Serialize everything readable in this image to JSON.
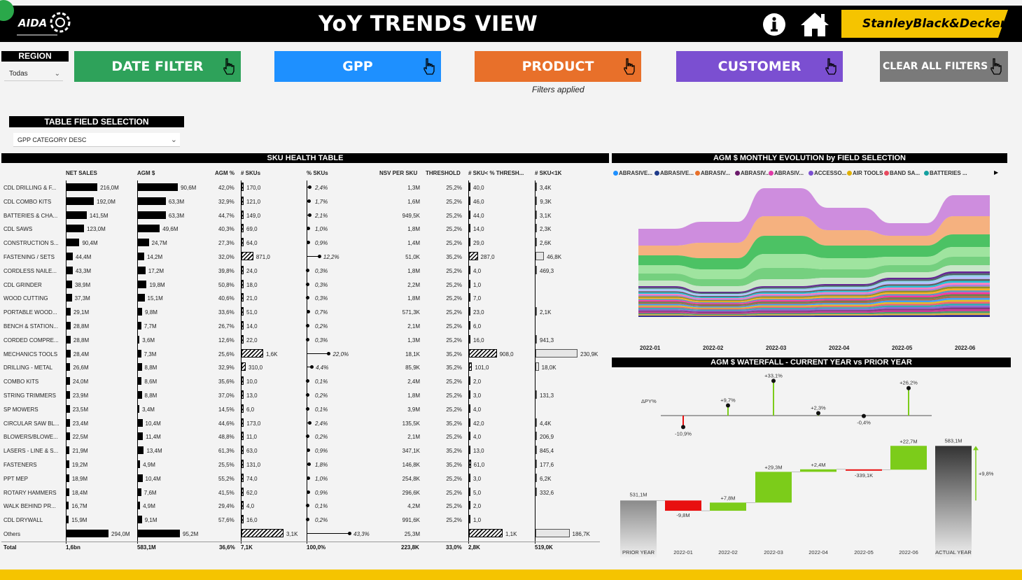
{
  "header": {
    "logo_text": "AIDA",
    "title": "YoY TRENDS VIEW",
    "brand": "StanleyBlack&Decker"
  },
  "region": {
    "label": "REGION",
    "value": "Todas"
  },
  "nav": {
    "date_filter": "DATE FILTER",
    "gpp": "GPP",
    "product": "PRODUCT",
    "customer": "CUSTOMER",
    "clear": "CLEAR ALL FILTERS",
    "filters_applied": "Filters applied"
  },
  "colors": {
    "date": "#2ea25a",
    "gpp": "#1e90ff",
    "product": "#e8702a",
    "customer": "#7b4fd1",
    "clear": "#7a7a7a",
    "footer": "#f5c400"
  },
  "table_field": {
    "label": "TABLE FIELD SELECTION",
    "value": "GPP CATEGORY DESC"
  },
  "sku_table": {
    "title": "SKU HEALTH TABLE",
    "columns": [
      "NET SALES",
      "AGM $",
      "AGM %",
      "# SKUs",
      "% SKUs",
      "NSV PER SKU",
      "THRESHOLD",
      "# SKU< % THRESH...",
      "# SKU<1K"
    ],
    "rows": [
      {
        "name": "CDL DRILLING & F...",
        "net_sales": "216,0M",
        "ns": 216.0,
        "agm": "90,6M",
        "agm_v": 90.6,
        "agm_pct": "42,0%",
        "skus": "170,0",
        "skus_v": 170,
        "pct_skus": "2,4%",
        "pct_v": 2.4,
        "nsv": "1,3M",
        "thr": "25,2%",
        "below": "40,0",
        "below_v": 40,
        "lt1k": "3,4K",
        "lt1k_v": 3.4
      },
      {
        "name": "CDL COMBO KITS",
        "net_sales": "192,0M",
        "ns": 192.0,
        "agm": "63,3M",
        "agm_v": 63.3,
        "agm_pct": "32,9%",
        "skus": "121,0",
        "skus_v": 121,
        "pct_skus": "1,7%",
        "pct_v": 1.7,
        "nsv": "1,6M",
        "thr": "25,2%",
        "below": "46,0",
        "below_v": 46,
        "lt1k": "9,3K",
        "lt1k_v": 9.3
      },
      {
        "name": "BATTERIES & CHA...",
        "net_sales": "141,5M",
        "ns": 141.5,
        "agm": "63,3M",
        "agm_v": 63.3,
        "agm_pct": "44,7%",
        "skus": "149,0",
        "skus_v": 149,
        "pct_skus": "2,1%",
        "pct_v": 2.1,
        "nsv": "949,5K",
        "thr": "25,2%",
        "below": "44,0",
        "below_v": 44,
        "lt1k": "3,1K",
        "lt1k_v": 3.1
      },
      {
        "name": "CDL SAWS",
        "net_sales": "123,0M",
        "ns": 123.0,
        "agm": "49,6M",
        "agm_v": 49.6,
        "agm_pct": "40,3%",
        "skus": "69,0",
        "skus_v": 69,
        "pct_skus": "1,0%",
        "pct_v": 1.0,
        "nsv": "1,8M",
        "thr": "25,2%",
        "below": "14,0",
        "below_v": 14,
        "lt1k": "2,3K",
        "lt1k_v": 2.3
      },
      {
        "name": "CONSTRUCTION S...",
        "net_sales": "90,4M",
        "ns": 90.4,
        "agm": "24,7M",
        "agm_v": 24.7,
        "agm_pct": "27,3%",
        "skus": "64,0",
        "skus_v": 64,
        "pct_skus": "0,9%",
        "pct_v": 0.9,
        "nsv": "1,4M",
        "thr": "25,2%",
        "below": "29,0",
        "below_v": 29,
        "lt1k": "2,6K",
        "lt1k_v": 2.6
      },
      {
        "name": "FASTENING / SETS",
        "net_sales": "44,4M",
        "ns": 44.4,
        "agm": "14,2M",
        "agm_v": 14.2,
        "agm_pct": "32,0%",
        "skus": "871,0",
        "skus_v": 871,
        "pct_skus": "12,2%",
        "pct_v": 12.2,
        "nsv": "51,0K",
        "thr": "35,2%",
        "below": "287,0",
        "below_v": 287,
        "lt1k": "46,8K",
        "lt1k_v": 46.8
      },
      {
        "name": "CORDLESS NAILE...",
        "net_sales": "43,3M",
        "ns": 43.3,
        "agm": "17,2M",
        "agm_v": 17.2,
        "agm_pct": "39,8%",
        "skus": "24,0",
        "skus_v": 24,
        "pct_skus": "0,3%",
        "pct_v": 0.3,
        "nsv": "1,8M",
        "thr": "25,2%",
        "below": "4,0",
        "below_v": 4,
        "lt1k": "469,3",
        "lt1k_v": 0.4693
      },
      {
        "name": "CDL GRINDER",
        "net_sales": "38,9M",
        "ns": 38.9,
        "agm": "19,8M",
        "agm_v": 19.8,
        "agm_pct": "50,8%",
        "skus": "18,0",
        "skus_v": 18,
        "pct_skus": "0,3%",
        "pct_v": 0.3,
        "nsv": "2,2M",
        "thr": "25,2%",
        "below": "1,0",
        "below_v": 1,
        "lt1k": "",
        "lt1k_v": 0
      },
      {
        "name": "WOOD CUTTING",
        "net_sales": "37,3M",
        "ns": 37.3,
        "agm": "15,1M",
        "agm_v": 15.1,
        "agm_pct": "40,6%",
        "skus": "21,0",
        "skus_v": 21,
        "pct_skus": "0,3%",
        "pct_v": 0.3,
        "nsv": "1,8M",
        "thr": "25,2%",
        "below": "7,0",
        "below_v": 7,
        "lt1k": "",
        "lt1k_v": 0
      },
      {
        "name": "PORTABLE WOOD...",
        "net_sales": "29,1M",
        "ns": 29.1,
        "agm": "9,8M",
        "agm_v": 9.8,
        "agm_pct": "33,6%",
        "skus": "51,0",
        "skus_v": 51,
        "pct_skus": "0,7%",
        "pct_v": 0.7,
        "nsv": "571,3K",
        "thr": "25,2%",
        "below": "23,0",
        "below_v": 23,
        "lt1k": "2,1K",
        "lt1k_v": 2.1
      },
      {
        "name": "BENCH & STATION...",
        "net_sales": "28,8M",
        "ns": 28.8,
        "agm": "7,7M",
        "agm_v": 7.7,
        "agm_pct": "26,7%",
        "skus": "14,0",
        "skus_v": 14,
        "pct_skus": "0,2%",
        "pct_v": 0.2,
        "nsv": "2,1M",
        "thr": "25,2%",
        "below": "6,0",
        "below_v": 6,
        "lt1k": "",
        "lt1k_v": 0
      },
      {
        "name": "CORDED COMPRE...",
        "net_sales": "28,8M",
        "ns": 28.8,
        "agm": "3,6M",
        "agm_v": 3.6,
        "agm_pct": "12,6%",
        "skus": "22,0",
        "skus_v": 22,
        "pct_skus": "0,3%",
        "pct_v": 0.3,
        "nsv": "1,3M",
        "thr": "25,2%",
        "below": "16,0",
        "below_v": 16,
        "lt1k": "941,3",
        "lt1k_v": 0.9413
      },
      {
        "name": "MECHANICS TOOLS",
        "net_sales": "28,4M",
        "ns": 28.4,
        "agm": "7,3M",
        "agm_v": 7.3,
        "agm_pct": "25,6%",
        "skus": "1,6K",
        "skus_v": 1600,
        "pct_skus": "22,0%",
        "pct_v": 22.0,
        "nsv": "18,1K",
        "thr": "35,2%",
        "below": "908,0",
        "below_v": 908,
        "lt1k": "230,9K",
        "lt1k_v": 230.9
      },
      {
        "name": "DRILLING - METAL",
        "net_sales": "26,6M",
        "ns": 26.6,
        "agm": "8,8M",
        "agm_v": 8.8,
        "agm_pct": "32,9%",
        "skus": "310,0",
        "skus_v": 310,
        "pct_skus": "4,4%",
        "pct_v": 4.4,
        "nsv": "85,9K",
        "thr": "35,2%",
        "below": "101,0",
        "below_v": 101,
        "lt1k": "18,0K",
        "lt1k_v": 18.0
      },
      {
        "name": "COMBO KITS",
        "net_sales": "24,0M",
        "ns": 24.0,
        "agm": "8,6M",
        "agm_v": 8.6,
        "agm_pct": "35,6%",
        "skus": "10,0",
        "skus_v": 10,
        "pct_skus": "0,1%",
        "pct_v": 0.1,
        "nsv": "2,4M",
        "thr": "25,2%",
        "below": "2,0",
        "below_v": 2,
        "lt1k": "",
        "lt1k_v": 0
      },
      {
        "name": "STRING TRIMMERS",
        "net_sales": "23,9M",
        "ns": 23.9,
        "agm": "8,8M",
        "agm_v": 8.8,
        "agm_pct": "37,0%",
        "skus": "13,0",
        "skus_v": 13,
        "pct_skus": "0,2%",
        "pct_v": 0.2,
        "nsv": "1,8M",
        "thr": "25,2%",
        "below": "3,0",
        "below_v": 3,
        "lt1k": "131,3",
        "lt1k_v": 0.1313
      },
      {
        "name": "SP MOWERS",
        "net_sales": "23,5M",
        "ns": 23.5,
        "agm": "3,4M",
        "agm_v": 3.4,
        "agm_pct": "14,5%",
        "skus": "6,0",
        "skus_v": 6,
        "pct_skus": "0,1%",
        "pct_v": 0.1,
        "nsv": "3,9M",
        "thr": "25,2%",
        "below": "4,0",
        "below_v": 4,
        "lt1k": "",
        "lt1k_v": 0
      },
      {
        "name": "CIRCULAR SAW BL...",
        "net_sales": "23,4M",
        "ns": 23.4,
        "agm": "10,4M",
        "agm_v": 10.4,
        "agm_pct": "44,6%",
        "skus": "173,0",
        "skus_v": 173,
        "pct_skus": "2,4%",
        "pct_v": 2.4,
        "nsv": "135,5K",
        "thr": "35,2%",
        "below": "42,0",
        "below_v": 42,
        "lt1k": "4,4K",
        "lt1k_v": 4.4
      },
      {
        "name": "BLOWERS/BLOWE...",
        "net_sales": "22,5M",
        "ns": 22.5,
        "agm": "11,4M",
        "agm_v": 11.4,
        "agm_pct": "48,8%",
        "skus": "11,0",
        "skus_v": 11,
        "pct_skus": "0,2%",
        "pct_v": 0.2,
        "nsv": "2,1M",
        "thr": "25,2%",
        "below": "4,0",
        "below_v": 4,
        "lt1k": "206,9",
        "lt1k_v": 0.2069
      },
      {
        "name": "LASERS - LINE & S...",
        "net_sales": "21,9M",
        "ns": 21.9,
        "agm": "13,4M",
        "agm_v": 13.4,
        "agm_pct": "61,3%",
        "skus": "63,0",
        "skus_v": 63,
        "pct_skus": "0,9%",
        "pct_v": 0.9,
        "nsv": "347,1K",
        "thr": "35,2%",
        "below": "13,0",
        "below_v": 13,
        "lt1k": "845,4",
        "lt1k_v": 0.8454
      },
      {
        "name": "FASTENERS",
        "net_sales": "19,2M",
        "ns": 19.2,
        "agm": "4,9M",
        "agm_v": 4.9,
        "agm_pct": "25,5%",
        "skus": "131,0",
        "skus_v": 131,
        "pct_skus": "1,8%",
        "pct_v": 1.8,
        "nsv": "146,8K",
        "thr": "35,2%",
        "below": "61,0",
        "below_v": 61,
        "lt1k": "177,6",
        "lt1k_v": 0.1776
      },
      {
        "name": "PPT MEP",
        "net_sales": "18,9M",
        "ns": 18.9,
        "agm": "10,4M",
        "agm_v": 10.4,
        "agm_pct": "55,2%",
        "skus": "74,0",
        "skus_v": 74,
        "pct_skus": "1,0%",
        "pct_v": 1.0,
        "nsv": "254,8K",
        "thr": "25,2%",
        "below": "3,0",
        "below_v": 3,
        "lt1k": "6,2K",
        "lt1k_v": 6.2
      },
      {
        "name": "ROTARY HAMMERS",
        "net_sales": "18,4M",
        "ns": 18.4,
        "agm": "7,6M",
        "agm_v": 7.6,
        "agm_pct": "41,5%",
        "skus": "62,0",
        "skus_v": 62,
        "pct_skus": "0,9%",
        "pct_v": 0.9,
        "nsv": "296,6K",
        "thr": "25,2%",
        "below": "5,0",
        "below_v": 5,
        "lt1k": "332,6",
        "lt1k_v": 0.3326
      },
      {
        "name": "WALK BEHIND PR...",
        "net_sales": "16,7M",
        "ns": 16.7,
        "agm": "4,9M",
        "agm_v": 4.9,
        "agm_pct": "29,4%",
        "skus": "4,0",
        "skus_v": 4,
        "pct_skus": "0,1%",
        "pct_v": 0.1,
        "nsv": "4,2M",
        "thr": "25,2%",
        "below": "2,0",
        "below_v": 2,
        "lt1k": "",
        "lt1k_v": 0
      },
      {
        "name": "CDL DRYWALL",
        "net_sales": "15,9M",
        "ns": 15.9,
        "agm": "9,1M",
        "agm_v": 9.1,
        "agm_pct": "57,6%",
        "skus": "16,0",
        "skus_v": 16,
        "pct_skus": "0,2%",
        "pct_v": 0.2,
        "nsv": "991,6K",
        "thr": "25,2%",
        "below": "1,0",
        "below_v": 1,
        "lt1k": "",
        "lt1k_v": 0
      },
      {
        "name": "Others",
        "net_sales": "294,0M",
        "ns": 294.0,
        "agm": "95,2M",
        "agm_v": 95.2,
        "agm_pct": "",
        "skus": "3,1K",
        "skus_v": 3100,
        "pct_skus": "43,3%",
        "pct_v": 43.3,
        "nsv": "25,3M",
        "thr": "",
        "below": "1,1K",
        "below_v": 1100,
        "lt1k": "186,7K",
        "lt1k_v": 186.7
      }
    ],
    "total": {
      "name": "Total",
      "net_sales": "1,6bn",
      "agm": "583,1M",
      "agm_pct": "36,6%",
      "skus": "7,1K",
      "pct_skus": "100,0%",
      "nsv": "223,8K",
      "thr": "33,0%",
      "below": "2,8K",
      "lt1k": "519,0K"
    }
  },
  "agm_evolution": {
    "title": "AGM $ MONTHLY EVOLUTION by FIELD SELECTION",
    "legend": [
      {
        "name": "ABRASIVE...",
        "color": "#1e90ff"
      },
      {
        "name": "ABRASIVE...",
        "color": "#1f3a8a"
      },
      {
        "name": "ABRASIV...",
        "color": "#e8702a"
      },
      {
        "name": "ABRASIV...",
        "color": "#6b1a6b"
      },
      {
        "name": "ABRASIV...",
        "color": "#e03aa8"
      },
      {
        "name": "ACCESSO...",
        "color": "#7b4fd1"
      },
      {
        "name": "AIR TOOLS",
        "color": "#e0b000"
      },
      {
        "name": "BAND SA...",
        "color": "#e84a5f"
      },
      {
        "name": "BATTERIES ...",
        "color": "#14a0a0"
      }
    ],
    "months": [
      "2022-01",
      "2022-02",
      "2022-03",
      "2022-04",
      "2022-05",
      "2022-06"
    ]
  },
  "waterfall": {
    "title": "AGM $ WATERFALL - CURRENT YEAR vs PRIOR YEAR",
    "dpy_label": "ΔPY%",
    "categories": [
      "PRIOR YEAR",
      "2022-01",
      "2022-02",
      "2022-03",
      "2022-04",
      "2022-05",
      "2022-06",
      "ACTUAL YEAR"
    ],
    "values": [
      531.1,
      -9.8,
      7.8,
      29.3,
      2.4,
      -0.339,
      22.7,
      583.1
    ],
    "value_labels": [
      "531,1M",
      "-9,8M",
      "+7,8M",
      "+29,3M",
      "+2,4M",
      "-339,1K",
      "+22,7M",
      "583,1M"
    ],
    "pct": [
      null,
      -10.9,
      9.7,
      33.1,
      2.3,
      -0.4,
      26.2,
      null
    ],
    "pct_labels": [
      "",
      "-10,9%",
      "+9,7%",
      "+33,1%",
      "+2,3%",
      "-0,4%",
      "+26,2%",
      ""
    ],
    "total_change_label": "+9,8%"
  }
}
